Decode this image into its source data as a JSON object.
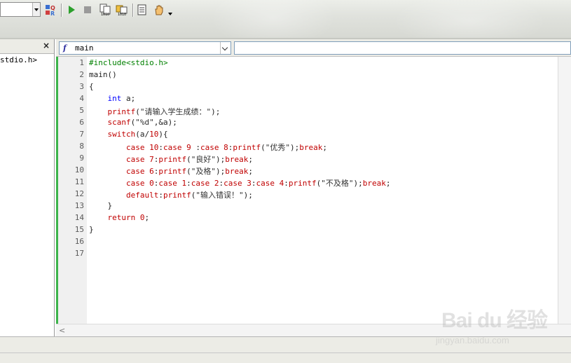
{
  "toolbar": {
    "icons": [
      "dropdown-combo",
      "compile-icon",
      "run-icon",
      "stop-icon",
      "build-icon",
      "rebuild-icon",
      "debug-icon",
      "hand-icon",
      "more-arrow-icon"
    ],
    "run_color": "#2ca02c"
  },
  "left_panel": {
    "close_glyph": "×",
    "item": "stdio.h>"
  },
  "navbar": {
    "function_icon": "f",
    "function_value": "main",
    "member_value": ""
  },
  "editor": {
    "line_numbers": [
      "1",
      "2",
      "3",
      "4",
      "5",
      "6",
      "7",
      "8",
      "9",
      "10",
      "11",
      "12",
      "13",
      "14",
      "15",
      "16",
      "17"
    ],
    "accent_color": "#3cb44b",
    "lines": [
      "#include<stdio.h>",
      "main()",
      "{",
      "    int a;",
      "    printf(\"请输入学生成绩：\");",
      "    scanf(\"%d\",&a);",
      "    switch(a/10){",
      "        case 10:case 9 :case 8:printf(\"优秀\");break;",
      "        case 7:printf(\"良好\");break;",
      "        case 6:printf(\"及格\");break;",
      "        case 0:case 1:case 2:case 3:case 4:printf(\"不及格\");break;",
      "        default:printf(\"输入错误！\");",
      "    }",
      "    return 0;",
      "}",
      "",
      ""
    ]
  },
  "hscroll": {
    "left_arrow": "<"
  },
  "watermark": {
    "brand": "Bai du 经验",
    "url": "jingyan.baidu.com"
  }
}
